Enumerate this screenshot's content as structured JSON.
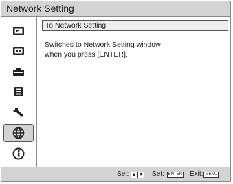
{
  "window": {
    "title": "Network Setting"
  },
  "sidebar": {
    "items": [
      {
        "icon": "picture-icon",
        "selected": false
      },
      {
        "icon": "screen-icon",
        "selected": false
      },
      {
        "icon": "connection-icon",
        "selected": false
      },
      {
        "icon": "installation-menu-icon",
        "selected": false
      },
      {
        "icon": "wrench-icon",
        "selected": false
      },
      {
        "icon": "globe-network-icon",
        "selected": true
      },
      {
        "icon": "information-icon",
        "selected": false
      }
    ]
  },
  "main": {
    "header": "To Network Setting",
    "description_line1": "Switches to Network Setting window",
    "description_line2": "when you press [ENTER]."
  },
  "status": {
    "sel_label": "Sel:",
    "up_key": "▲",
    "down_key": "▼",
    "set_label": "Set:",
    "enter_key": "ENTER",
    "exit_label": "Exit:",
    "menu_key": "MENU"
  }
}
